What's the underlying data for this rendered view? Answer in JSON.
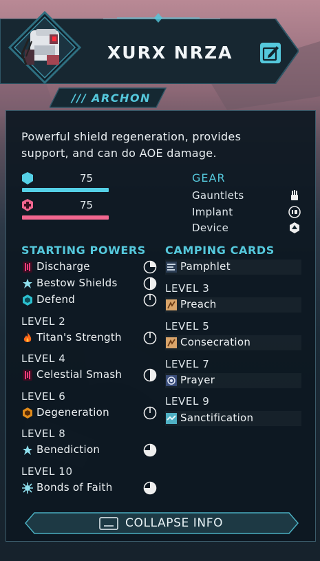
{
  "character": {
    "name": "XURX NRZA",
    "class": "/// ARCHON",
    "description": "Powerful shield regeneration, provides support, and can do AOE damage."
  },
  "stats": {
    "shield": {
      "value": "75",
      "icon": "shield-icon",
      "color": "#55d0e6"
    },
    "health": {
      "value": "75",
      "icon": "health-cross-icon",
      "color": "#f2668f"
    }
  },
  "gear": {
    "title": "GEAR",
    "items": [
      {
        "label": "Gauntlets",
        "icon": "gauntlet-icon"
      },
      {
        "label": "Implant",
        "icon": "implant-icon"
      },
      {
        "label": "Device",
        "icon": "device-icon"
      }
    ]
  },
  "powers": {
    "title": "STARTING POWERS",
    "starting": [
      {
        "label": "Discharge",
        "icon": "discharge-icon",
        "cooldown": 0.25
      },
      {
        "label": "Bestow Shields",
        "icon": "bestow-shields-icon",
        "cooldown": 0.5
      },
      {
        "label": "Defend",
        "icon": "defend-icon",
        "cooldown": 0
      }
    ],
    "levels": [
      {
        "level": "LEVEL 2",
        "label": "Titan's Strength",
        "icon": "flame-icon",
        "cooldown": 0
      },
      {
        "level": "LEVEL 4",
        "label": "Celestial Smash",
        "icon": "celestial-smash-icon",
        "cooldown": 0.5
      },
      {
        "level": "LEVEL 6",
        "label": "Degeneration",
        "icon": "degeneration-icon",
        "cooldown": 0
      },
      {
        "level": "LEVEL 8",
        "label": "Benediction",
        "icon": "benediction-icon",
        "cooldown": 0.75
      },
      {
        "level": "LEVEL 10",
        "label": "Bonds of Faith",
        "icon": "bonds-of-faith-icon",
        "cooldown": 0.75
      }
    ]
  },
  "cards": {
    "title": "CAMPING CARDS",
    "starting": {
      "label": "Pamphlet",
      "icon": "pamphlet-icon"
    },
    "levels": [
      {
        "level": "LEVEL 3",
        "label": "Preach",
        "icon": "preach-icon"
      },
      {
        "level": "LEVEL 5",
        "label": "Consecration",
        "icon": "consecration-icon"
      },
      {
        "level": "LEVEL 7",
        "label": "Prayer",
        "icon": "prayer-icon"
      },
      {
        "level": "LEVEL 9",
        "label": "Sanctification",
        "icon": "sanctification-icon"
      }
    ]
  },
  "collapse_button": {
    "label": "COLLAPSE INFO"
  },
  "colors": {
    "accent": "#55c8dc",
    "panel": "#0d1821",
    "shield": "#55d0e6",
    "health": "#f2668f"
  }
}
